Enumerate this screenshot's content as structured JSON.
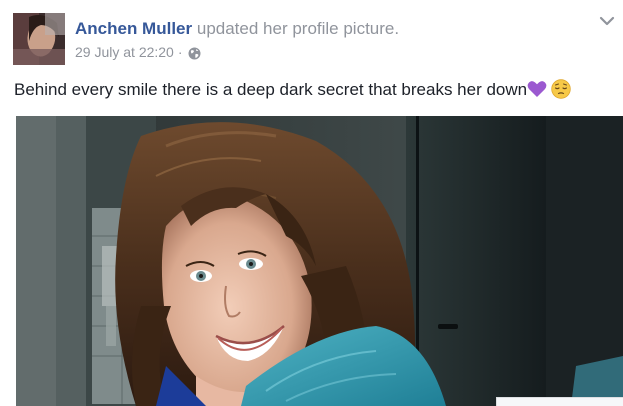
{
  "post": {
    "author": "Anchen Muller",
    "action": "updated her profile picture.",
    "timestamp": "29 July at 22:20",
    "separator": "·",
    "privacy_icon": "globe-icon",
    "menu_icon": "chevron-down-icon",
    "caption": "Behind every smile there is a deep dark secret that breaks her down",
    "caption_emojis": [
      "purple-heart-emoji",
      "pensive-face-emoji"
    ]
  },
  "colors": {
    "author_link": "#365899",
    "secondary_text": "#90949c",
    "body_text": "#1d2129",
    "purple_heart": "#9b59d0",
    "emoji_face": "#f7c948"
  }
}
